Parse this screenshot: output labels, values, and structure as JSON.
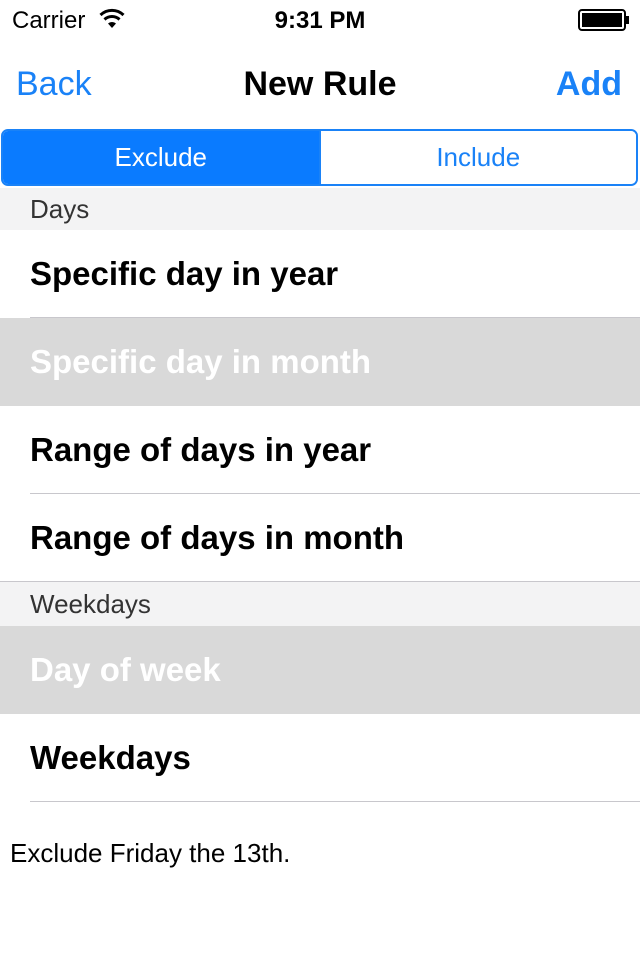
{
  "status_bar": {
    "carrier": "Carrier",
    "time": "9:31 PM",
    "wifi_icon": "wifi-icon",
    "battery_icon": "battery-icon",
    "battery_level": 1.0
  },
  "nav_bar": {
    "back_label": "Back",
    "title": "New Rule",
    "add_label": "Add"
  },
  "segmented_control": {
    "segments": [
      "Exclude",
      "Include"
    ],
    "selected": "Exclude"
  },
  "sections": [
    {
      "header": "Days",
      "rows": [
        "Specific day in year",
        "Specific day in month",
        "Range of days in year",
        "Range of days in month"
      ]
    },
    {
      "header": "Weekdays",
      "rows": [
        "Day of week",
        "Weekdays"
      ]
    }
  ],
  "highlighted_rows": [
    "Specific day in month",
    "Day of week"
  ],
  "footer_text": "Exclude Friday the 13th.",
  "colors": {
    "accent": "#1a82f7",
    "segment_selected_bg": "#0a7bff",
    "section_header_bg": "#f3f3f4",
    "row_highlight_bg": "#d9d9d9"
  }
}
